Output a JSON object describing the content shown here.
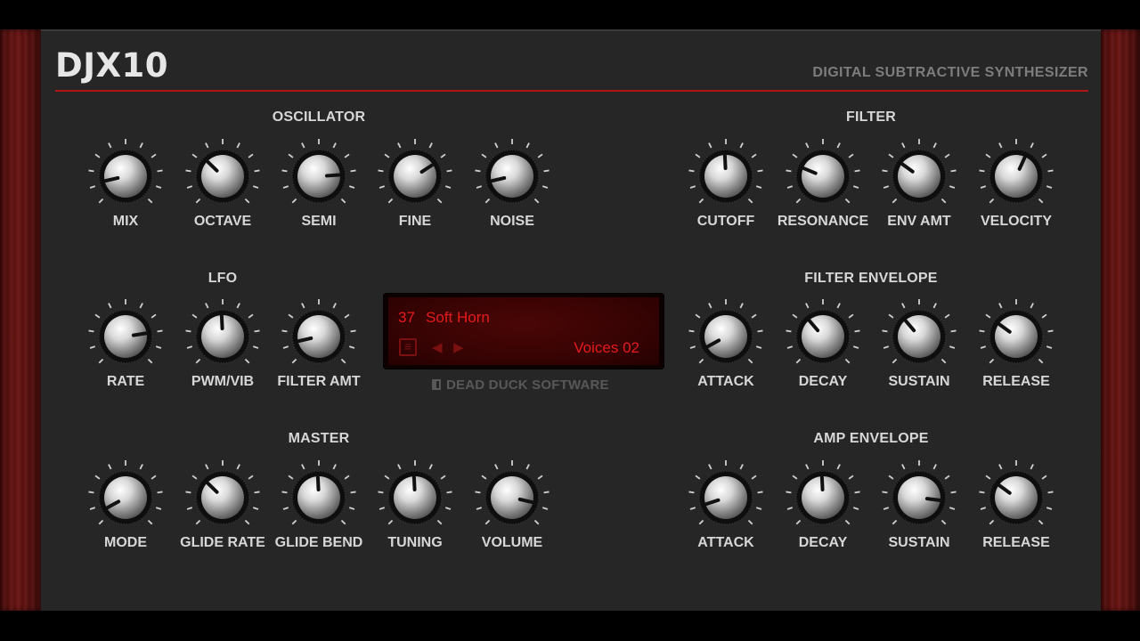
{
  "header": {
    "logo": "DJX10",
    "subtitle": "DIGITAL SUBTRACTIVE SYNTHESIZER"
  },
  "colors": {
    "accent": "#b31212",
    "lcd_text": "#e61b1b",
    "panel": "#262626",
    "wood": "#6b1614"
  },
  "sections": {
    "oscillator": {
      "title": "OSCILLATOR",
      "knobs": [
        {
          "label": "MIX",
          "level": 0.12
        },
        {
          "label": "OCTAVE",
          "level": 0.33
        },
        {
          "label": "SEMI",
          "level": 0.82
        },
        {
          "label": "FINE",
          "level": 0.71
        },
        {
          "label": "NOISE",
          "level": 0.12
        }
      ]
    },
    "filter": {
      "title": "FILTER",
      "knobs": [
        {
          "label": "CUTOFF",
          "level": 0.49
        },
        {
          "label": "RESONANCE",
          "level": 0.25
        },
        {
          "label": "ENV AMT",
          "level": 0.3
        },
        {
          "label": "VELOCITY",
          "level": 0.59
        }
      ]
    },
    "lfo": {
      "title": "LFO",
      "knobs": [
        {
          "label": "RATE",
          "level": 0.8
        },
        {
          "label": "PWM/VIB",
          "level": 0.49
        },
        {
          "label": "FILTER AMT",
          "level": 0.12
        }
      ]
    },
    "filter_envelope": {
      "title": "FILTER ENVELOPE",
      "knobs": [
        {
          "label": "ATTACK",
          "level": 0.06
        },
        {
          "label": "DECAY",
          "level": 0.35
        },
        {
          "label": "SUSTAIN",
          "level": 0.35
        },
        {
          "label": "RELEASE",
          "level": 0.3
        }
      ]
    },
    "master": {
      "title": "MASTER",
      "knobs": [
        {
          "label": "MODE",
          "level": 0.06
        },
        {
          "label": "GLIDE RATE",
          "level": 0.33
        },
        {
          "label": "GLIDE BEND",
          "level": 0.49
        },
        {
          "label": "TUNING",
          "level": 0.49
        },
        {
          "label": "VOLUME",
          "level": 0.88
        }
      ]
    },
    "amp_envelope": {
      "title": "AMP ENVELOPE",
      "knobs": [
        {
          "label": "ATTACK",
          "level": 0.1
        },
        {
          "label": "DECAY",
          "level": 0.49
        },
        {
          "label": "SUSTAIN",
          "level": 0.86
        },
        {
          "label": "RELEASE",
          "level": 0.3
        }
      ]
    }
  },
  "display": {
    "preset_number": "37",
    "preset_name": "Soft Horn",
    "voices": "Voices 02",
    "menu_icon": "menu-icon",
    "prev_icon": "prev-arrow-icon",
    "next_icon": "next-arrow-icon"
  },
  "brand": "DEAD DUCK SOFTWARE"
}
